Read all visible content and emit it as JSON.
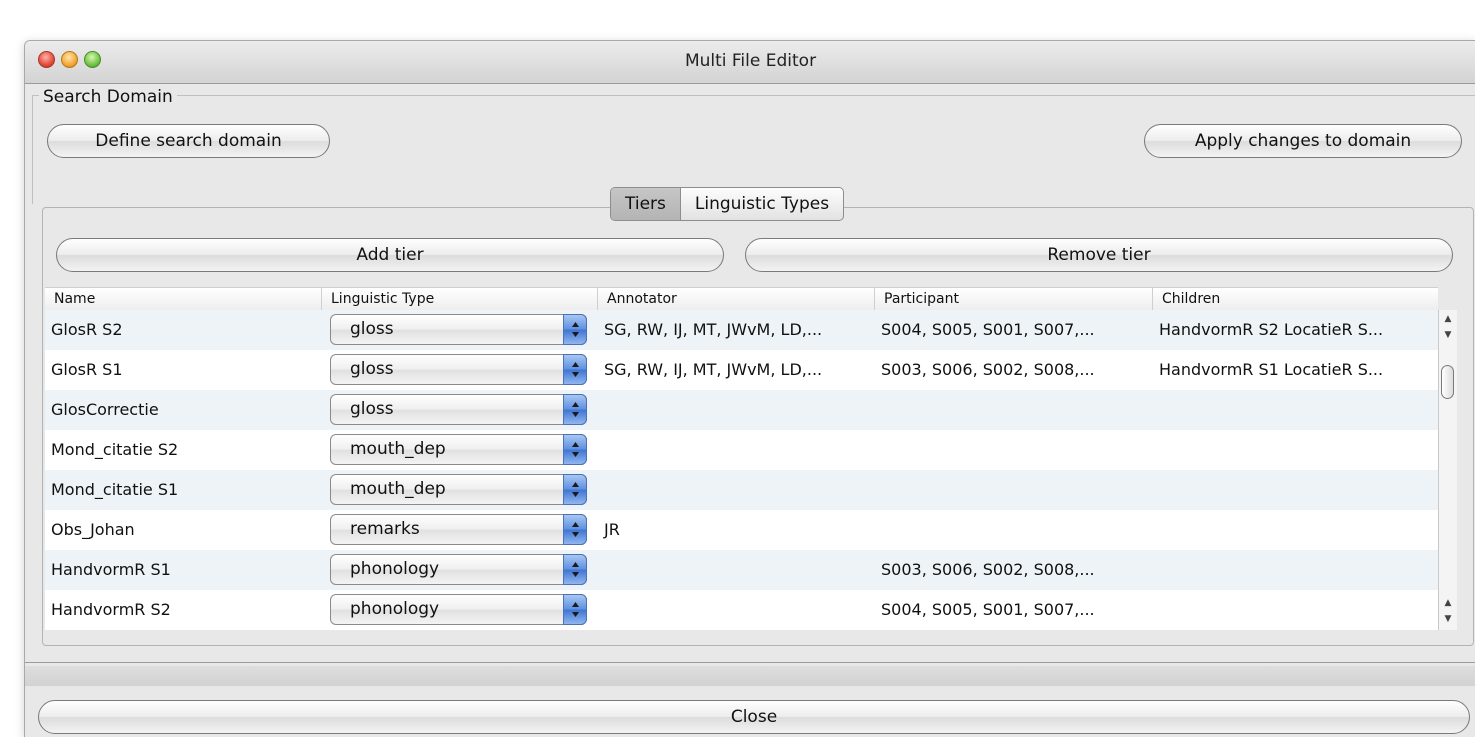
{
  "window": {
    "title": "Multi File Editor"
  },
  "search_domain": {
    "legend": "Search Domain",
    "define_button": "Define search domain",
    "apply_button": "Apply changes to domain"
  },
  "tabs": [
    {
      "label": "Tiers",
      "active": true
    },
    {
      "label": "Linguistic Types",
      "active": false
    }
  ],
  "tier_buttons": {
    "add": "Add tier",
    "remove": "Remove tier"
  },
  "table": {
    "columns": [
      "Name",
      "Linguistic Type",
      "Annotator",
      "Participant",
      "Children"
    ],
    "rows": [
      {
        "name": "GlosR S2",
        "type": "gloss",
        "annotator": "SG, RW, IJ, MT, JWvM, LD,...",
        "participant": "S004, S005, S001, S007,...",
        "children": "HandvormR S2 LocatieR S..."
      },
      {
        "name": "GlosR S1",
        "type": "gloss",
        "annotator": "SG, RW, IJ, MT, JWvM, LD,...",
        "participant": "S003, S006, S002, S008,...",
        "children": "HandvormR S1 LocatieR S..."
      },
      {
        "name": "GlosCorrectie",
        "type": "gloss",
        "annotator": "",
        "participant": "",
        "children": ""
      },
      {
        "name": "Mond_citatie S2",
        "type": "mouth_dep",
        "annotator": "",
        "participant": "",
        "children": ""
      },
      {
        "name": "Mond_citatie S1",
        "type": "mouth_dep",
        "annotator": "",
        "participant": "",
        "children": ""
      },
      {
        "name": "Obs_Johan",
        "type": "remarks",
        "annotator": "JR",
        "participant": "",
        "children": ""
      },
      {
        "name": "HandvormR S1",
        "type": "phonology",
        "annotator": "",
        "participant": "S003, S006, S002, S008,...",
        "children": ""
      },
      {
        "name": "HandvormR S2",
        "type": "phonology",
        "annotator": "",
        "participant": "S004, S005, S001, S007,...",
        "children": ""
      }
    ]
  },
  "close_button": "Close",
  "colors": {
    "row_alt": "#edf3f6",
    "combo_accent": "#3f74d2"
  }
}
